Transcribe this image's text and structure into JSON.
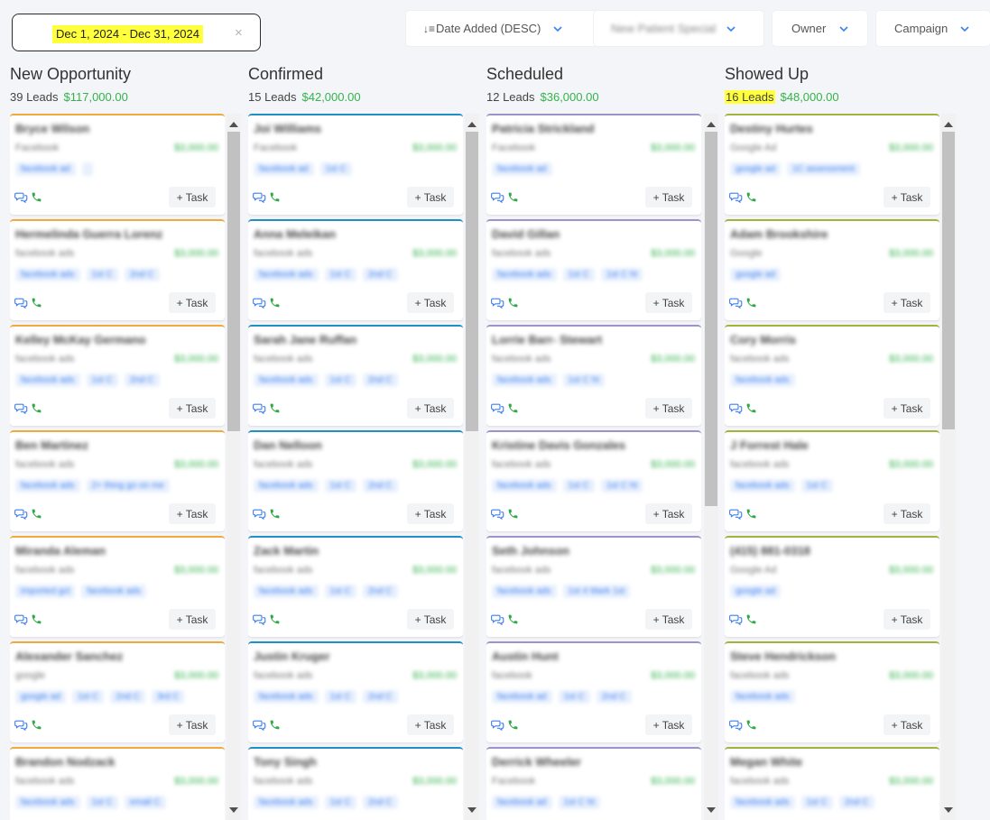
{
  "toolbar": {
    "date_range": "Dec 1, 2024 - Dec 31, 2024",
    "clear_symbol": "×",
    "filters": [
      {
        "name": "sort",
        "label": "Date Added (DESC)",
        "blurred": false
      },
      {
        "name": "pipeline",
        "label": "New Patient Special",
        "blurred": true
      },
      {
        "name": "owner",
        "label": "Owner",
        "blurred": false
      },
      {
        "name": "campaign",
        "label": "Campaign",
        "blurred": false
      }
    ]
  },
  "colors": {
    "new_opportunity": "#f0a93b",
    "confirmed": "#1f8fc4",
    "scheduled": "#9c94c8",
    "showed_up": "#a3b23a",
    "amount": "#34b34a",
    "highlight": "#ffff3c"
  },
  "task_label": "+ Task",
  "columns": [
    {
      "key": "new_opportunity",
      "title": "New Opportunity",
      "count": "39 Leads",
      "amount": "$117,000.00",
      "highlight_count": false,
      "cards": [
        {
          "name": "Bryce Wilson",
          "source": "Facebook",
          "value": "$3,000.00",
          "tags": [
            "facebook ad",
            ""
          ]
        },
        {
          "name": "Hermelinda Guerra Lorenz",
          "source": "facebook ads",
          "value": "$3,000.00",
          "tags": [
            "facebook ads",
            "1st C",
            "2nd C"
          ]
        },
        {
          "name": "Kelley McKay Germano",
          "source": "facebook ads",
          "value": "$3,000.00",
          "tags": [
            "facebook ads",
            "1st C",
            "2nd C"
          ]
        },
        {
          "name": "Ben Martinez",
          "source": "facebook ads",
          "value": "$3,000.00",
          "tags": [
            "facebook ads",
            "2+ thing go on me"
          ]
        },
        {
          "name": "Miranda Aleman",
          "source": "facebook ads",
          "value": "$3,000.00",
          "tags": [
            "imported gcl",
            "facebook ads"
          ]
        },
        {
          "name": "Alexander Sanchez",
          "source": "google",
          "value": "$3,000.00",
          "tags": [
            "google ad",
            "1st C",
            "2nd C",
            "3rd C"
          ]
        },
        {
          "name": "Brandon Nodzack",
          "source": "facebook ads",
          "value": "$3,000.00",
          "tags": [
            "facebook ads",
            "1st C",
            "email C"
          ]
        }
      ]
    },
    {
      "key": "confirmed",
      "title": "Confirmed",
      "count": "15 Leads",
      "amount": "$42,000.00",
      "highlight_count": false,
      "cards": [
        {
          "name": "Joi Williams",
          "source": "Facebook",
          "value": "$3,000.00",
          "tags": [
            "facebook ad",
            "1st C"
          ]
        },
        {
          "name": "Anna Meleikan",
          "source": "facebook ads",
          "value": "$3,000.00",
          "tags": [
            "facebook ads",
            "1st C",
            "2nd C"
          ]
        },
        {
          "name": "Sarah Jane Ruffan",
          "source": "facebook ads",
          "value": "$3,000.00",
          "tags": [
            "facebook ads",
            "1st C",
            "2nd C"
          ]
        },
        {
          "name": "Dan Nelloon",
          "source": "facebook ads",
          "value": "$3,000.00",
          "tags": [
            "facebook ads",
            "1st C",
            "2nd C"
          ]
        },
        {
          "name": "Zack Martin",
          "source": "facebook ads",
          "value": "$3,000.00",
          "tags": [
            "facebook ads",
            "1st C",
            "2nd C"
          ]
        },
        {
          "name": "Justin Kruger",
          "source": "facebook ads",
          "value": "$3,000.00",
          "tags": [
            "facebook ads",
            "1st C",
            "2nd C"
          ]
        },
        {
          "name": "Tony Singh",
          "source": "facebook ads",
          "value": "$3,000.00",
          "tags": [
            "facebook ads",
            "1st C",
            "2nd C"
          ]
        }
      ]
    },
    {
      "key": "scheduled",
      "title": "Scheduled",
      "count": "12 Leads",
      "amount": "$36,000.00",
      "highlight_count": false,
      "cards": [
        {
          "name": "Patricia Strickland",
          "source": "Facebook",
          "value": "$3,000.00",
          "tags": [
            "facebook ad"
          ]
        },
        {
          "name": "David Gillan",
          "source": "facebook ads",
          "value": "$3,000.00",
          "tags": [
            "facebook ads",
            "1st C",
            "1st C ht"
          ]
        },
        {
          "name": "Lorrie Barr- Stewart",
          "source": "facebook ads",
          "value": "$3,000.00",
          "tags": [
            "facebook ads",
            "1st C ht"
          ]
        },
        {
          "name": "Kristine Davis Gonzales",
          "source": "facebook ads",
          "value": "$3,000.00",
          "tags": [
            "facebook ads",
            "1st C",
            "1st C ht"
          ]
        },
        {
          "name": "Seth Johnson",
          "source": "facebook ads",
          "value": "$3,000.00",
          "tags": [
            "facebook ads",
            "1st 4 Mark 1st"
          ]
        },
        {
          "name": "Austin Hunt",
          "source": "facebook",
          "value": "$3,000.00",
          "tags": [
            "facebook ad",
            "1st C",
            "2nd C"
          ]
        },
        {
          "name": "Derrick Wheeler",
          "source": "Facebook",
          "value": "$3,000.00",
          "tags": [
            "facebook ad",
            "1st C ht"
          ]
        }
      ]
    },
    {
      "key": "showed_up",
      "title": "Showed Up",
      "count": "16 Leads",
      "amount": "$48,000.00",
      "highlight_count": true,
      "cards": [
        {
          "name": "Destiny Hurtes",
          "source": "Google Ad",
          "value": "$3,000.00",
          "tags": [
            "google ad",
            "1C assessment"
          ]
        },
        {
          "name": "Adam Brookshire",
          "source": "Google",
          "value": "$3,000.00",
          "tags": [
            "google ad"
          ]
        },
        {
          "name": "Cory Morris",
          "source": "facebook ads",
          "value": "$3,000.00",
          "tags": [
            "facebook ads"
          ]
        },
        {
          "name": "J Forrest Hale",
          "source": "facebook ads",
          "value": "$3,000.00",
          "tags": [
            "facebook ads",
            "1st C"
          ]
        },
        {
          "name": "(415) 881-0318",
          "source": "Google Ad",
          "value": "$3,000.00",
          "tags": [
            "google ad"
          ]
        },
        {
          "name": "Steve Hendrickson",
          "source": "facebook ads",
          "value": "$3,000.00",
          "tags": [
            "facebook ads"
          ]
        },
        {
          "name": "Megan White",
          "source": "facebook ads",
          "value": "$3,000.00",
          "tags": [
            "facebook ads",
            "1st C",
            "2nd C"
          ]
        }
      ]
    }
  ]
}
